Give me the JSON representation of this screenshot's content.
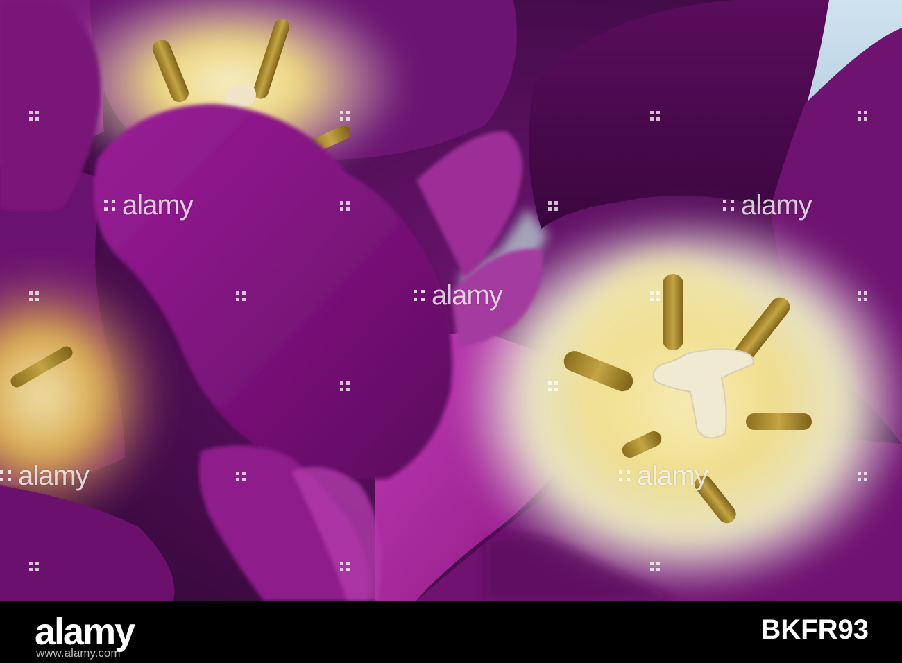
{
  "photo": {
    "subject": "purple-tulips-close-up",
    "colors": {
      "petal_dark": "#4a0a4f",
      "petal_mid": "#8a1a86",
      "petal_bright": "#b12ea6",
      "center_yellow": "#e9d36a",
      "center_cream": "#f2efd2",
      "stamen": "#a58a2b",
      "sky": "#b9d6e8"
    }
  },
  "watermark": {
    "text": "alamy"
  },
  "footer": {
    "logo": "alamy",
    "image_id": "BKFR93",
    "url": "www.alamy.com"
  }
}
